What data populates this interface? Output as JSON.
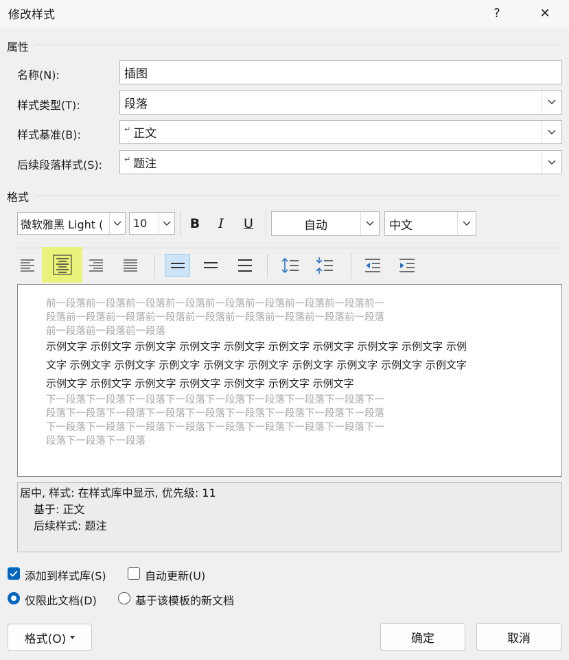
{
  "window": {
    "title": "修改样式",
    "help": "?",
    "close": "✕"
  },
  "properties": {
    "section_label": "属性",
    "name_label": "名称(N):",
    "name_value": "插图",
    "type_label": "样式类型(T):",
    "type_value": "段落",
    "based_label": "样式基准(B):",
    "based_value": "正文",
    "next_label": "后续段落样式(S):",
    "next_value": "题注"
  },
  "format": {
    "section_label": "格式",
    "font": "微软雅黑 Light (",
    "size": "10",
    "bold": "B",
    "italic": "I",
    "underline": "U",
    "color": "自动",
    "script": "中文"
  },
  "preview": {
    "prev_lines": [
      "前一段落前一段落前一段落前一段落前一段落前一段落前一段落前一段落前一",
      "段落前一段落前一段落前一段落前一段落前一段落前一段落前一段落前一段落",
      "前一段落前一段落前一段落"
    ],
    "sample_lines": [
      "示例文字  示例文字  示例文字  示例文字  示例文字  示例文字  示例文字  示例文字  示例文字  示例",
      "文字  示例文字  示例文字  示例文字  示例文字  示例文字  示例文字  示例文字  示例文字  示例文字",
      "示例文字  示例文字  示例文字  示例文字  示例文字  示例文字  示例文字"
    ],
    "next_lines": [
      "下一段落下一段落下一段落下一段落下一段落下一段落下一段落下一段落下一",
      "段落下一段落下一段落下一段落下一段落下一段落下一段落下一段落下一段落",
      "下一段落下一段落下一段落下一段落下一段落下一段落下一段落下一段落下一",
      "段落下一段落下一段落"
    ]
  },
  "description": {
    "line1": "居中, 样式: 在样式库中显示, 优先级: 11",
    "line2": "基于: 正文",
    "line3": "后续样式: 题注"
  },
  "options": {
    "add_to_gallery": "添加到样式库(S)",
    "add_to_gallery_checked": true,
    "auto_update": "自动更新(U)",
    "auto_update_checked": false,
    "this_doc_only": "仅限此文档(D)",
    "this_doc_only_selected": true,
    "new_docs": "基于该模板的新文档",
    "new_docs_selected": false
  },
  "buttons": {
    "format": "格式(O)",
    "ok": "确定",
    "cancel": "取消"
  },
  "colors": {
    "accent": "#0067c0",
    "highlight": "#e9f27a",
    "selected_btn": "#cce4f7"
  }
}
